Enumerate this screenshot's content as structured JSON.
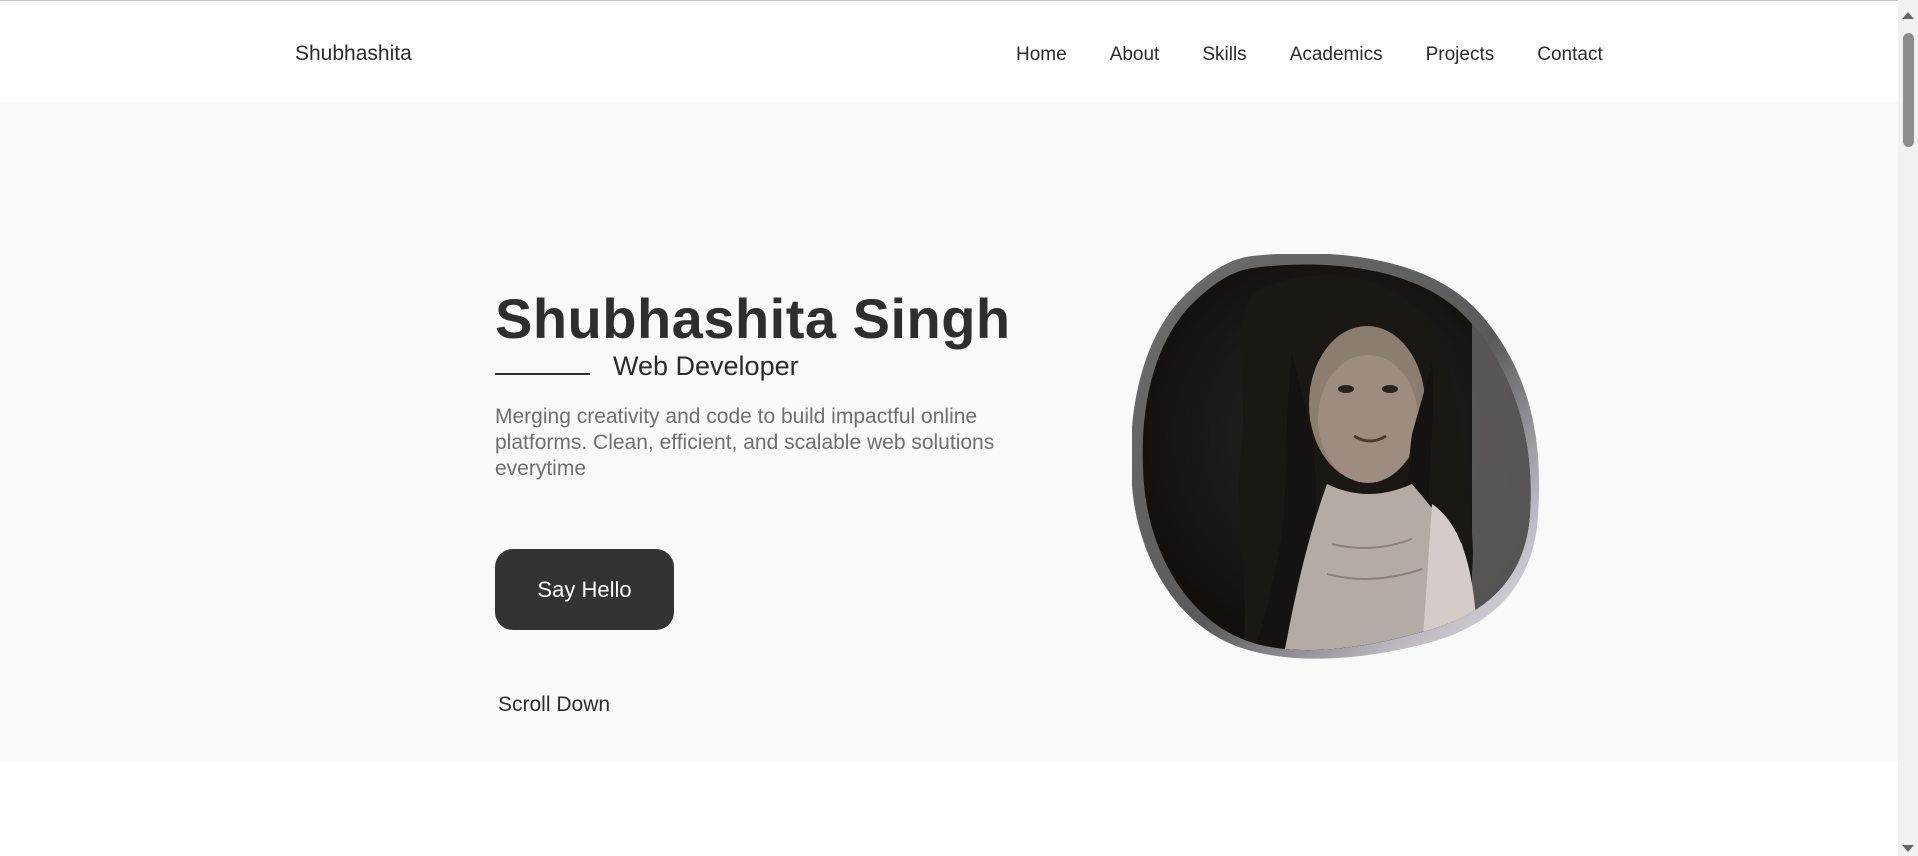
{
  "brand": "Shubhashita",
  "nav": [
    "Home",
    "About",
    "Skills",
    "Academics",
    "Projects",
    "Contact"
  ],
  "hero": {
    "name": "Shubhashita Singh",
    "role": "Web Developer",
    "description": "Merging creativity and code to build impactful online platforms. Clean, efficient, and scalable web solutions everytime",
    "cta": "Say Hello",
    "scroll": "Scroll Down"
  },
  "colors": {
    "hero_background": "#f9f9f9",
    "button_background": "#333333",
    "text_primary": "#2e2e2e",
    "text_muted": "#6f6f6f"
  },
  "icons": {
    "scroll_up": "triangle-up",
    "scroll_down": "triangle-down"
  }
}
